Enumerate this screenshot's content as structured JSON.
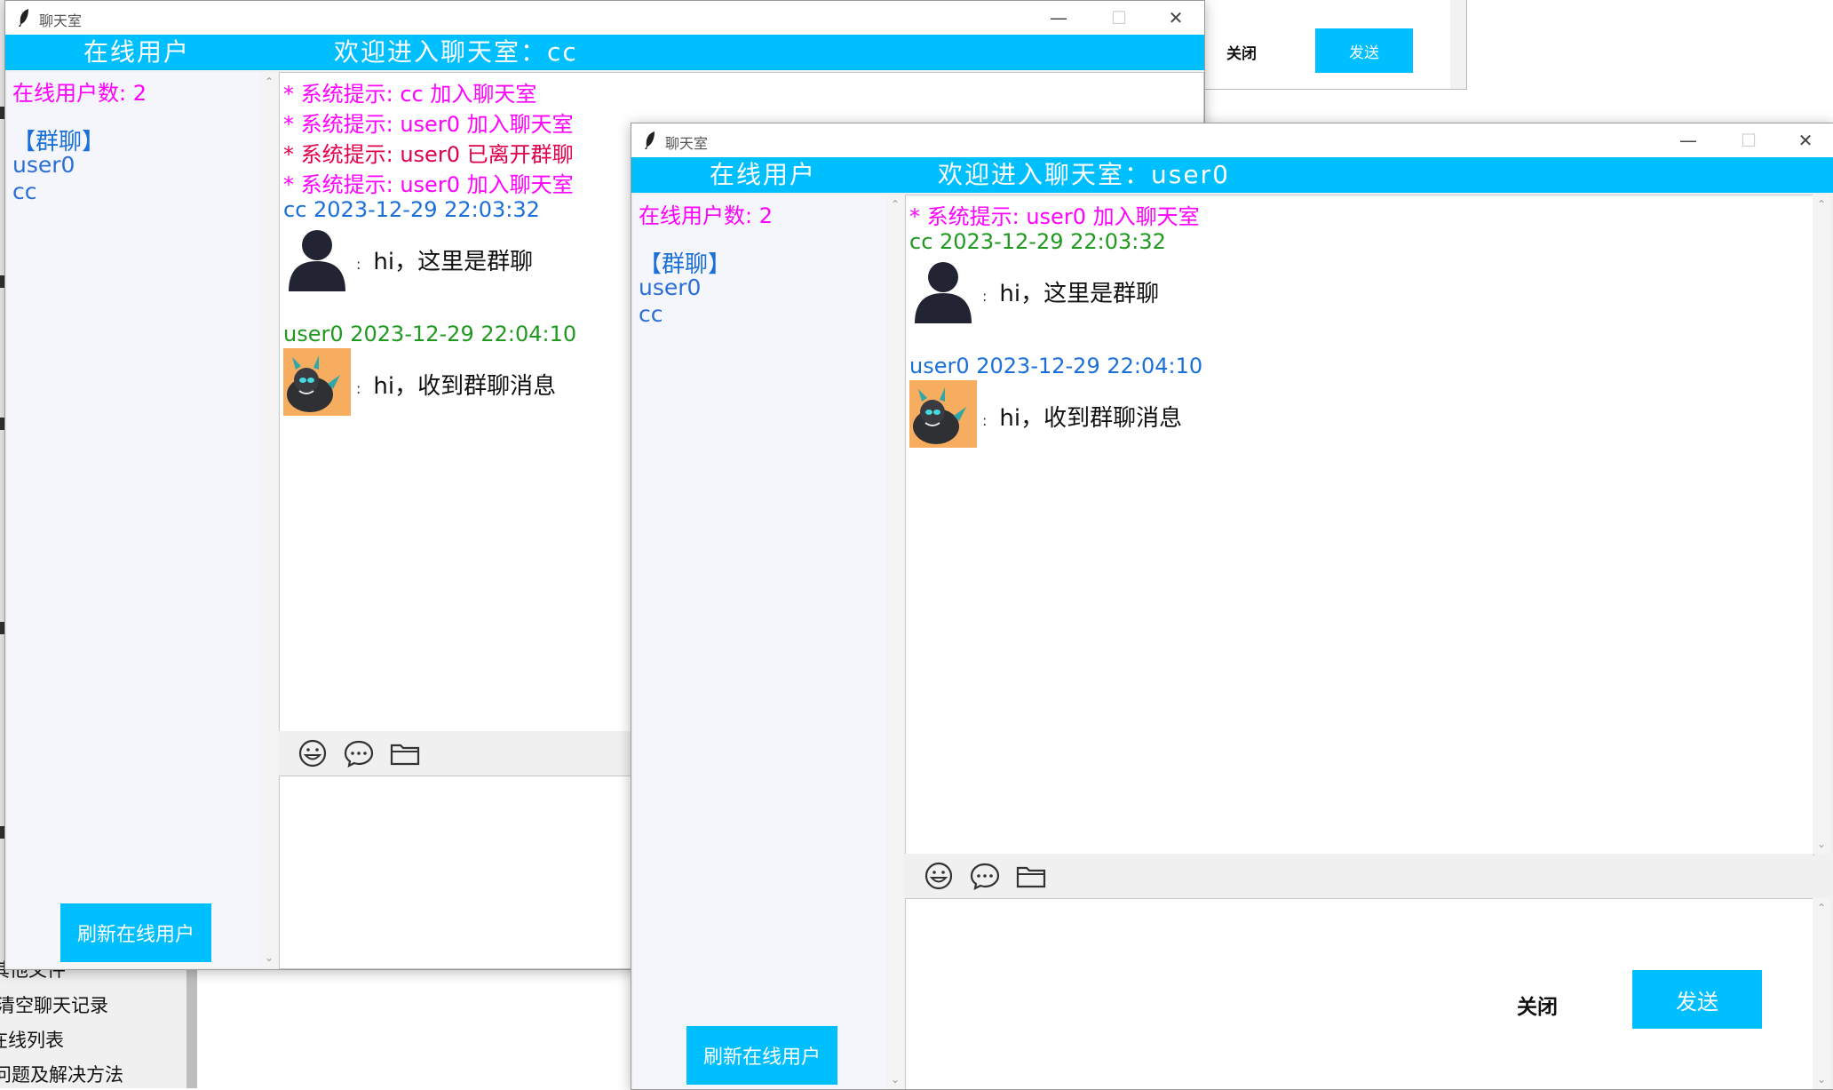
{
  "background": {
    "menu_items": [
      "其他文件",
      "清空聊天记录",
      "在线列表",
      "问题及解决方法"
    ],
    "other_window": {
      "close_label": "关闭",
      "send_label": "发送"
    }
  },
  "window_back": {
    "title": "聊天室",
    "header": {
      "online_label": "在线用户",
      "welcome": "欢迎进入聊天室：cc"
    },
    "online_count": "在线用户数: 2",
    "group_label": "【群聊】",
    "users": [
      "user0",
      "cc"
    ],
    "refresh_label": "刷新在线用户",
    "system_messages": [
      "* 系统提示: cc 加入聊天室",
      "* 系统提示: user0 加入聊天室",
      "* 系统提示: user0 已离开群聊",
      "* 系统提示: user0 加入聊天室"
    ],
    "messages": [
      {
        "meta": "cc 2023-12-29 22:03:32",
        "text": "hi，这里是群聊",
        "avatar": "silhouette"
      },
      {
        "meta": "user0 2023-12-29 22:04:10",
        "text": "hi，收到群聊消息",
        "avatar": "cartoon-dragon"
      }
    ]
  },
  "window_front": {
    "title": "聊天室",
    "header": {
      "online_label": "在线用户",
      "welcome": "欢迎进入聊天室：user0"
    },
    "online_count": "在线用户数: 2",
    "group_label": "【群聊】",
    "users": [
      "user0",
      "cc"
    ],
    "refresh_label": "刷新在线用户",
    "system_messages": [
      "* 系统提示: user0 加入聊天室"
    ],
    "messages": [
      {
        "meta": "cc 2023-12-29 22:03:32",
        "text": "hi，这里是群聊",
        "avatar": "silhouette"
      },
      {
        "meta": "user0 2023-12-29 22:04:10",
        "text": "hi，收到群聊消息",
        "avatar": "cartoon-dragon"
      }
    ],
    "close_label": "关闭",
    "send_label": "发送"
  },
  "icons": [
    "feather-icon",
    "minimize-icon",
    "maximize-icon",
    "close-icon",
    "emoji-icon",
    "chat-bubble-icon",
    "folder-icon"
  ],
  "colors": {
    "accent": "#00bfff",
    "system": "#ff00ff",
    "left_notice": "#e0004a",
    "own_meta": "#1f9a1f",
    "other_meta": "#1a6fd8"
  }
}
